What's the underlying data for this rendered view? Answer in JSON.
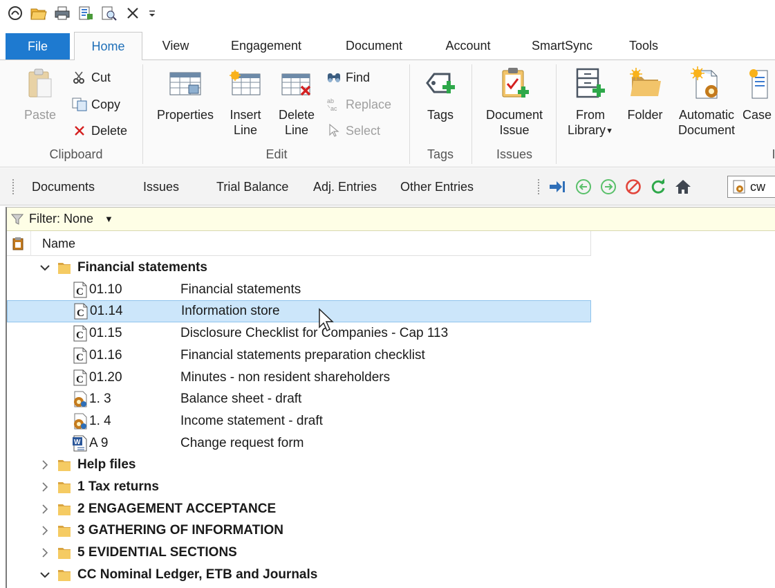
{
  "qat": {
    "icons": [
      "app-menu-icon",
      "open-folder-icon",
      "print-icon",
      "properties-icon",
      "print-preview-icon",
      "close-icon",
      "customize-dropdown-icon"
    ]
  },
  "tabs": {
    "file": "File",
    "home": "Home",
    "view": "View",
    "engagement": "Engagement",
    "document": "Document",
    "account": "Account",
    "smartsync": "SmartSync",
    "tools": "Tools"
  },
  "ribbon": {
    "clipboard": {
      "label": "Clipboard",
      "paste": "Paste",
      "cut": "Cut",
      "copy": "Copy",
      "delete": "Delete"
    },
    "edit": {
      "label": "Edit",
      "properties": "Properties",
      "insert_line": [
        "Insert",
        "Line"
      ],
      "delete_line": [
        "Delete",
        "Line"
      ],
      "find": "Find",
      "replace": "Replace",
      "select": "Select"
    },
    "tags": {
      "label": "Tags",
      "tags": "Tags"
    },
    "issues": {
      "label": "Issues",
      "document_issue": [
        "Document",
        "Issue"
      ]
    },
    "new": {
      "from_library": [
        "From",
        "Library"
      ],
      "folder": "Folder",
      "automatic_document": [
        "Automatic",
        "Document"
      ],
      "case": "Case"
    }
  },
  "toolbar2": {
    "documents": "Documents",
    "issues": "Issues",
    "trial_balance": "Trial Balance",
    "adj_entries": "Adj. Entries",
    "other_entries": "Other Entries",
    "box_text": "cw"
  },
  "filter": {
    "label": "Filter: None"
  },
  "tree": {
    "column_name": "Name",
    "rows": [
      {
        "type": "folder",
        "expanded": true,
        "title": "Financial statements"
      },
      {
        "type": "doc",
        "icon": "c",
        "code": "01.10",
        "desc": "Financial statements"
      },
      {
        "type": "doc",
        "icon": "c",
        "code": "01.14",
        "desc": "Information store",
        "selected": true
      },
      {
        "type": "doc",
        "icon": "c",
        "code": "01.15",
        "desc": "Disclosure Checklist for Companies - Cap 113"
      },
      {
        "type": "doc",
        "icon": "c",
        "code": "01.16",
        "desc": "Financial statements preparation checklist"
      },
      {
        "type": "doc",
        "icon": "c",
        "code": "01.20",
        "desc": "Minutes - non resident shareholders"
      },
      {
        "type": "doc",
        "icon": "auto",
        "code": "1. 3",
        "desc": "Balance sheet - draft"
      },
      {
        "type": "doc",
        "icon": "auto",
        "code": "1. 4",
        "desc": "Income statement - draft"
      },
      {
        "type": "doc",
        "icon": "word",
        "code": "A 9",
        "desc": "Change request form"
      },
      {
        "type": "folder",
        "expanded": false,
        "title": "Help files"
      },
      {
        "type": "folder",
        "expanded": false,
        "title": "1 Tax returns"
      },
      {
        "type": "folder",
        "expanded": false,
        "title": "2 ENGAGEMENT ACCEPTANCE"
      },
      {
        "type": "folder",
        "expanded": false,
        "title": "3 GATHERING OF INFORMATION"
      },
      {
        "type": "folder",
        "expanded": false,
        "title": "5 EVIDENTIAL SECTIONS"
      },
      {
        "type": "folder",
        "expanded": true,
        "title": "CC  Nominal Ledger, ETB and  Journals"
      }
    ]
  }
}
